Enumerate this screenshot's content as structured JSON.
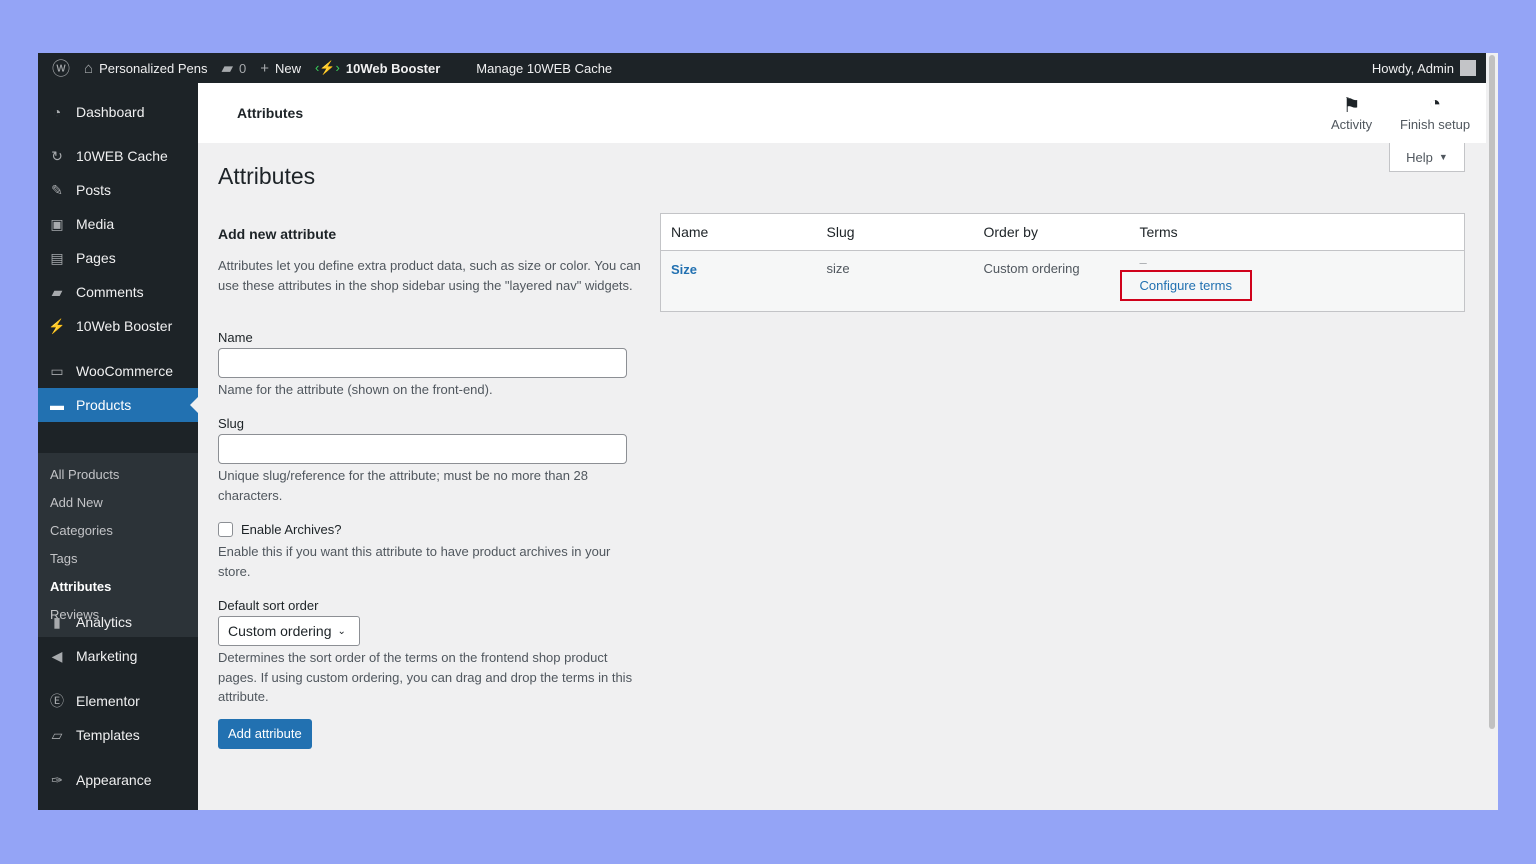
{
  "adminbar": {
    "site": "Personalized Pens",
    "comments": "0",
    "new": "New",
    "booster": "10Web Booster",
    "cache": "Manage 10WEB Cache",
    "howdy": "Howdy, Admin"
  },
  "sidebar": {
    "items": [
      "Dashboard",
      "10WEB Cache",
      "Posts",
      "Media",
      "Pages",
      "Comments",
      "10Web Booster",
      "WooCommerce",
      "Products",
      "Analytics",
      "Marketing",
      "Elementor",
      "Templates",
      "Appearance"
    ],
    "submenu": [
      "All Products",
      "Add New",
      "Categories",
      "Tags",
      "Attributes",
      "Reviews"
    ]
  },
  "header": {
    "title": "Attributes",
    "activity": "Activity",
    "finish": "Finish setup",
    "help": "Help"
  },
  "page": {
    "title": "Attributes",
    "form_title": "Add new attribute",
    "intro": "Attributes let you define extra product data, such as size or color. You can use these attributes in the shop sidebar using the \"layered nav\" widgets.",
    "name_label": "Name",
    "name_value": "",
    "name_help": "Name for the attribute (shown on the front-end).",
    "slug_label": "Slug",
    "slug_value": "",
    "slug_help": "Unique slug/reference for the attribute; must be no more than 28 characters.",
    "archives_label": "Enable Archives?",
    "archives_help": "Enable this if you want this attribute to have product archives in your store.",
    "sort_label": "Default sort order",
    "sort_value": "Custom ordering",
    "sort_help": "Determines the sort order of the terms on the frontend shop product pages. If using custom ordering, you can drag and drop the terms in this attribute.",
    "submit": "Add attribute"
  },
  "table": {
    "headers": [
      "Name",
      "Slug",
      "Order by",
      "Terms"
    ],
    "rows": [
      {
        "name": "Size",
        "slug": "size",
        "order": "Custom ordering",
        "terms": "–",
        "configure": "Configure terms"
      }
    ]
  }
}
